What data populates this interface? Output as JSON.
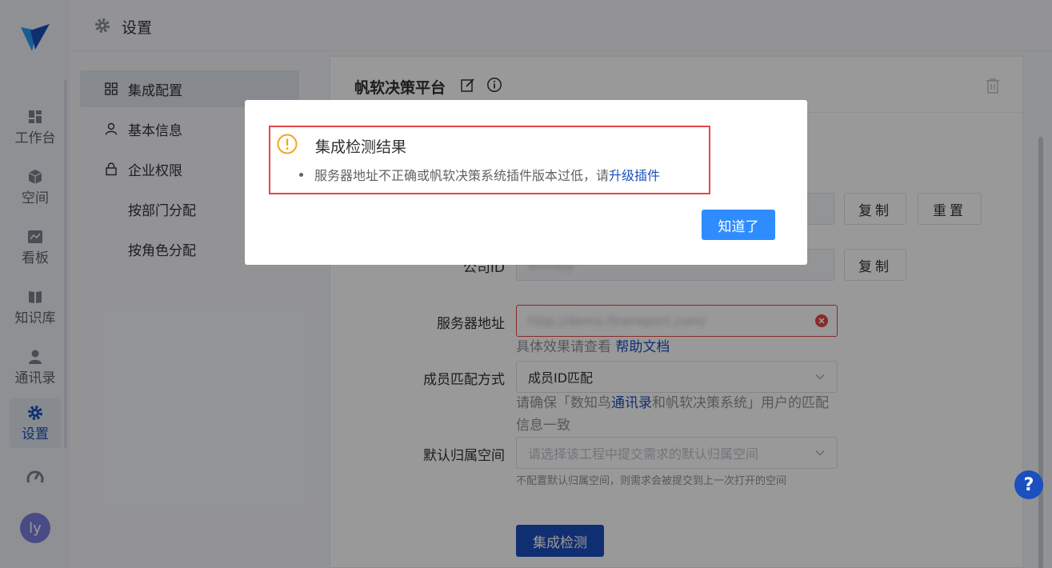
{
  "header": {
    "title": "设置"
  },
  "nav": {
    "items": [
      {
        "label": "工作台"
      },
      {
        "label": "空间"
      },
      {
        "label": "看板"
      },
      {
        "label": "知识库"
      },
      {
        "label": "通讯录"
      },
      {
        "label": "设置"
      }
    ],
    "avatar": "ly"
  },
  "menu": {
    "items": [
      {
        "label": "集成配置"
      },
      {
        "label": "基本信息"
      },
      {
        "label": "企业权限"
      },
      {
        "label": "按部门分配"
      },
      {
        "label": "按角色分配"
      }
    ]
  },
  "panel": {
    "title": "帆软决策平台",
    "copy_label": "复制",
    "reset_label": "重置",
    "company_id_label": "公司ID",
    "company_id_value": "4mhDy",
    "server_label": "服务器地址",
    "server_value": "http://demo.finereport.com/",
    "server_hint_prefix": "具体效果请查看",
    "server_hint_link": "帮助文档",
    "match_label": "成员匹配方式",
    "match_value": "成员ID匹配",
    "match_hint_1": "请确保「数知鸟",
    "match_hint_link": "通讯录",
    "match_hint_2": "和帆软决策系统」用户的匹配",
    "match_hint_3": "信息一致",
    "space_label": "默认归属空间",
    "space_placeholder": "请选择该工程中提交需求的默认归属空间",
    "space_hint": "不配置默认归属空间，则需求会被提交到上一次打开的空间",
    "check_button": "集成检测"
  },
  "dialog": {
    "title": "集成检测结果",
    "message": "服务器地址不正确或帆软决策系统插件版本过低，请",
    "message_link": "升级插件",
    "ok_button": "知道了"
  },
  "help": "?",
  "colors": {
    "primary": "#1c4fbf",
    "dialog_button": "#2f8cff",
    "error": "#e64545",
    "warning": "#f5a623"
  }
}
